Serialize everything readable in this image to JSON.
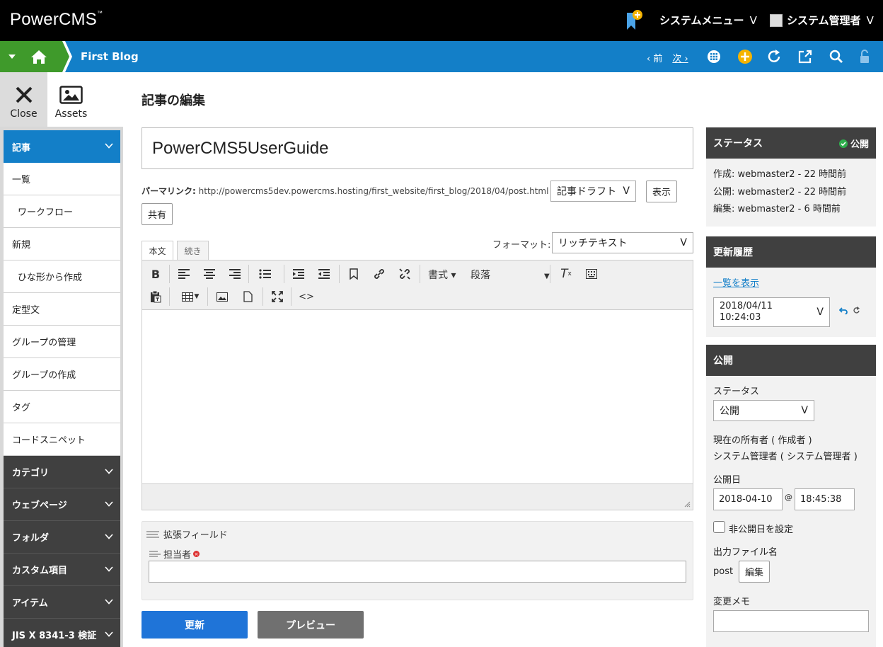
{
  "app": {
    "logo": "PowerCMS",
    "logo_tm": "™"
  },
  "header": {
    "system_menu": "システムメニュー",
    "user": "システム管理者",
    "chevron": "V"
  },
  "nav": {
    "blog_name": "First Blog",
    "prev": "‹ 前",
    "next": "次 ›"
  },
  "left_actions": {
    "close_label": "Close",
    "assets_label": "Assets"
  },
  "sidebar": {
    "items": [
      {
        "label": "記事",
        "type": "active"
      },
      {
        "label": "一覧",
        "type": "sub"
      },
      {
        "label": "ワークフロー",
        "type": "sub indent"
      },
      {
        "label": "新規",
        "type": "sub"
      },
      {
        "label": "ひな形から作成",
        "type": "sub indent"
      },
      {
        "label": "定型文",
        "type": "sub"
      },
      {
        "label": "グループの管理",
        "type": "sub"
      },
      {
        "label": "グループの作成",
        "type": "sub"
      },
      {
        "label": "タグ",
        "type": "sub"
      },
      {
        "label": "コードスニペット",
        "type": "sub"
      },
      {
        "label": "カテゴリ",
        "type": "dark"
      },
      {
        "label": "ウェブページ",
        "type": "dark"
      },
      {
        "label": "フォルダ",
        "type": "dark"
      },
      {
        "label": "カスタム項目",
        "type": "dark"
      },
      {
        "label": "アイテム",
        "type": "dark"
      },
      {
        "label": "JIS X 8341-3 検証",
        "type": "dark"
      }
    ]
  },
  "main": {
    "page_title": "記事の編集",
    "entry_title": "PowerCMS5UserGuide",
    "permalink_label": "パーマリンク:",
    "permalink_url": "http://powercms5dev.powercms.hosting/first_website/first_blog/2018/04/post.html",
    "draft_select": "記事ドラフト",
    "view_button": "表示",
    "share_button": "共有",
    "tab_body": "本文",
    "tab_more": "続き",
    "format_label": "フォーマット:",
    "format_value": "リッチテキスト",
    "toolbar": {
      "style": "書式",
      "paragraph": "段落"
    },
    "ext_fields_label": "拡張フィールド",
    "assignee_label": "担当者",
    "assignee_value": "",
    "save_button": "更新",
    "preview_button": "プレビュー"
  },
  "status_panel": {
    "title": "ステータス",
    "status_badge": "公開",
    "created": "作成: webmaster2 - 22 時間前",
    "published": "公開: webmaster2 - 22 時間前",
    "edited": "編集: webmaster2 - 6 時間前"
  },
  "history_panel": {
    "title": "更新履歴",
    "show_list": "一覧を表示",
    "revision_date": "2018/04/11",
    "revision_time": "10:24:03"
  },
  "publish_panel": {
    "title": "公開",
    "status_label": "ステータス",
    "status_value": "公開",
    "owner_label": "現在の所有者 ( 作成者 )",
    "owner_value": "システム管理者 ( システム管理者 )",
    "pubdate_label": "公開日",
    "pub_date": "2018-04-10",
    "at": "@",
    "pub_time": "18:45:38",
    "unpublish_label": "非公開日を設定",
    "filename_label": "出力ファイル名",
    "filename_value": "post",
    "edit_button": "編集",
    "memo_label": "変更メモ",
    "memo_value": ""
  },
  "colors": {
    "nav_blue": "#137fc8",
    "home_green": "#3f9a2b",
    "dark_panel": "#404040",
    "primary_btn": "#1f74d8"
  }
}
